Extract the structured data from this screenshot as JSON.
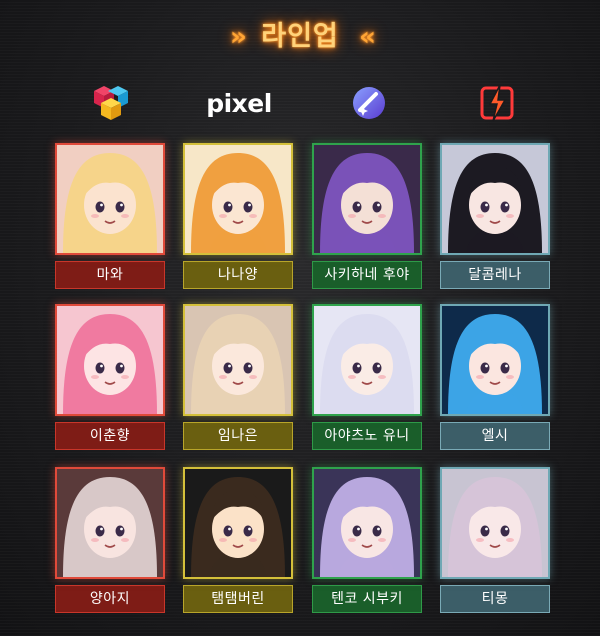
{
  "title": "라인업",
  "title_decoration": {
    "left": "»",
    "right": "«"
  },
  "brands": [
    {
      "name": "cube-logo"
    },
    {
      "name": "pixel-logo",
      "text": "pixel"
    },
    {
      "name": "star-circle-logo"
    },
    {
      "name": "lightning-logo"
    }
  ],
  "colors": {
    "red": "#c8362a",
    "yellow": "#b8a52a",
    "green": "#2f9a48",
    "teal": "#7aaab6",
    "title": "#ffd27a"
  },
  "members": [
    {
      "name": "마와",
      "group": "red",
      "hair": "#f6d48a",
      "skin": "#fbe3cf",
      "bg": "#f1cfc2"
    },
    {
      "name": "나나양",
      "group": "yellow",
      "hair": "#f0a040",
      "skin": "#fbe6d2",
      "bg": "#f7e7c8"
    },
    {
      "name": "사키하네 후야",
      "group": "green",
      "hair": "#7a52b8",
      "skin": "#f4e0d6",
      "bg": "#3a2a4a"
    },
    {
      "name": "달콤레나",
      "group": "teal",
      "hair": "#1c1a22",
      "skin": "#f8e6e2",
      "bg": "#c6c8d8"
    },
    {
      "name": "이춘향",
      "group": "red",
      "hair": "#f07aa0",
      "skin": "#fde4e4",
      "bg": "#f6c6d0"
    },
    {
      "name": "임나은",
      "group": "yellow",
      "hair": "#e8d2b4",
      "skin": "#fbe8dc",
      "bg": "#d9c5b3"
    },
    {
      "name": "아야츠노 유니",
      "group": "green",
      "hair": "#dcdcf0",
      "skin": "#faece6",
      "bg": "#e6e6f4"
    },
    {
      "name": "엘시",
      "group": "teal",
      "hair": "#3ca4e6",
      "skin": "#fbe6e0",
      "bg": "#0e2a4a"
    },
    {
      "name": "양아지",
      "group": "red",
      "hair": "#d8c8c8",
      "skin": "#f8e4e0",
      "bg": "#5a3a3a"
    },
    {
      "name": "탬탬버린",
      "group": "yellow",
      "hair": "#3a2a1e",
      "skin": "#fbe2c8",
      "bg": "#1a1a1a"
    },
    {
      "name": "텐코 시부키",
      "group": "green",
      "hair": "#b8a8de",
      "skin": "#f8e6e4",
      "bg": "#3a3458"
    },
    {
      "name": "티몽",
      "group": "teal",
      "hair": "#d6c4d8",
      "skin": "#f9e8e8",
      "bg": "#c8c4d2"
    }
  ]
}
